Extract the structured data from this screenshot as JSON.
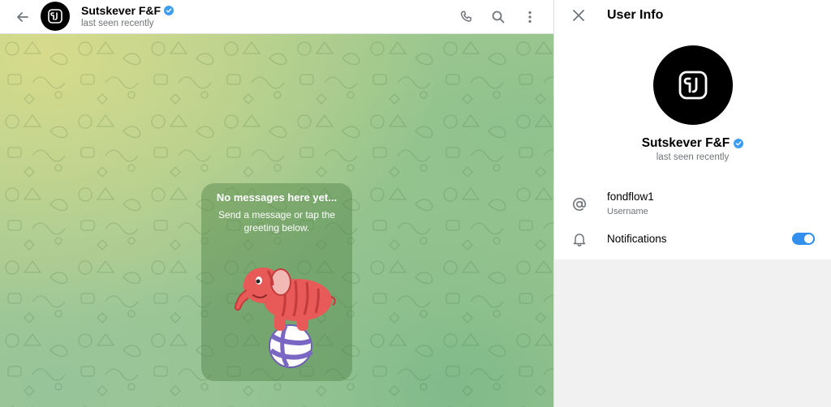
{
  "chat": {
    "title": "Sutskever F&F",
    "status": "last seen recently",
    "verified": true,
    "avatar_logo": "FJ",
    "header_icons": [
      "back-arrow-icon",
      "phone-icon",
      "search-icon",
      "more-vertical-icon"
    ]
  },
  "empty_state": {
    "title": "No messages here yet...",
    "subtitle": "Send a message or tap the greeting below.",
    "sticker": "elephant-on-ball-sticker"
  },
  "info_panel": {
    "title": "User Info",
    "name": "Sutskever F&F",
    "status": "last seen recently",
    "username": {
      "value": "fondflow1",
      "label": "Username",
      "icon": "at-sign-icon"
    },
    "notifications": {
      "label": "Notifications",
      "enabled": true,
      "icon": "bell-icon"
    }
  },
  "colors": {
    "accent": "#3390ec",
    "verified_badge": "#3d9df0",
    "secondary_text": "#707579",
    "sticker_elephant": "#e85a57",
    "panel_bg": "#f1f1f1"
  }
}
